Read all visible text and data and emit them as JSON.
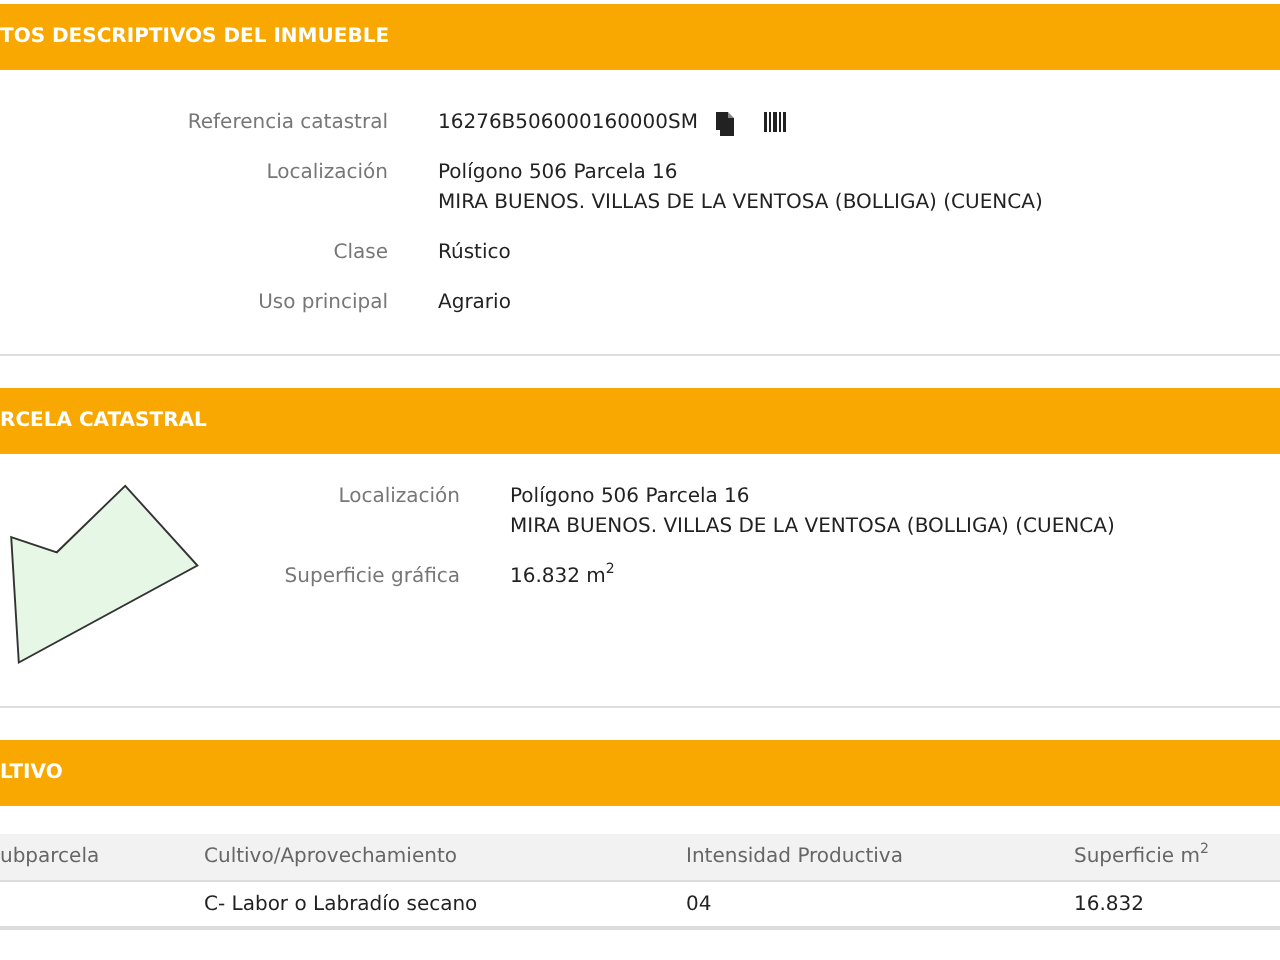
{
  "sections": [
    {
      "title": "TOS DESCRIPTIVOS DEL INMUEBLE",
      "fields": [
        {
          "label": "Referencia catastral",
          "lines": [
            "16276B506000160000SM"
          ],
          "icons": true
        },
        {
          "label": "Localización",
          "lines": [
            "Polígono 506 Parcela 16",
            "MIRA BUENOS. VILLAS DE LA VENTOSA (BOLLIGA) (CUENCA)"
          ]
        },
        {
          "label": "Clase",
          "lines": [
            "Rústico"
          ]
        },
        {
          "label": "Uso principal",
          "lines": [
            "Agrario"
          ]
        }
      ]
    },
    {
      "title": "RCELA CATASTRAL",
      "fields": [
        {
          "label": "Localización",
          "lines": [
            "Polígono 506 Parcela 16",
            "MIRA BUENOS. VILLAS DE LA VENTOSA (BOLLIGA) (CUENCA)"
          ]
        },
        {
          "label": "Superficie gráfica",
          "lines": [
            "16.832 m$^{2}$"
          ]
        }
      ]
    },
    {
      "title": "LTIVO",
      "table": {
        "columns": [
          "ubparcela",
          "Cultivo/Aprovechamiento",
          "Intensidad Productiva",
          "Superficie m$^{2}$"
        ],
        "rows": [
          {
            "cells": [
              "",
              "C- Labor o Labradío secano",
              "04",
              "16.832"
            ]
          }
        ]
      }
    }
  ]
}
